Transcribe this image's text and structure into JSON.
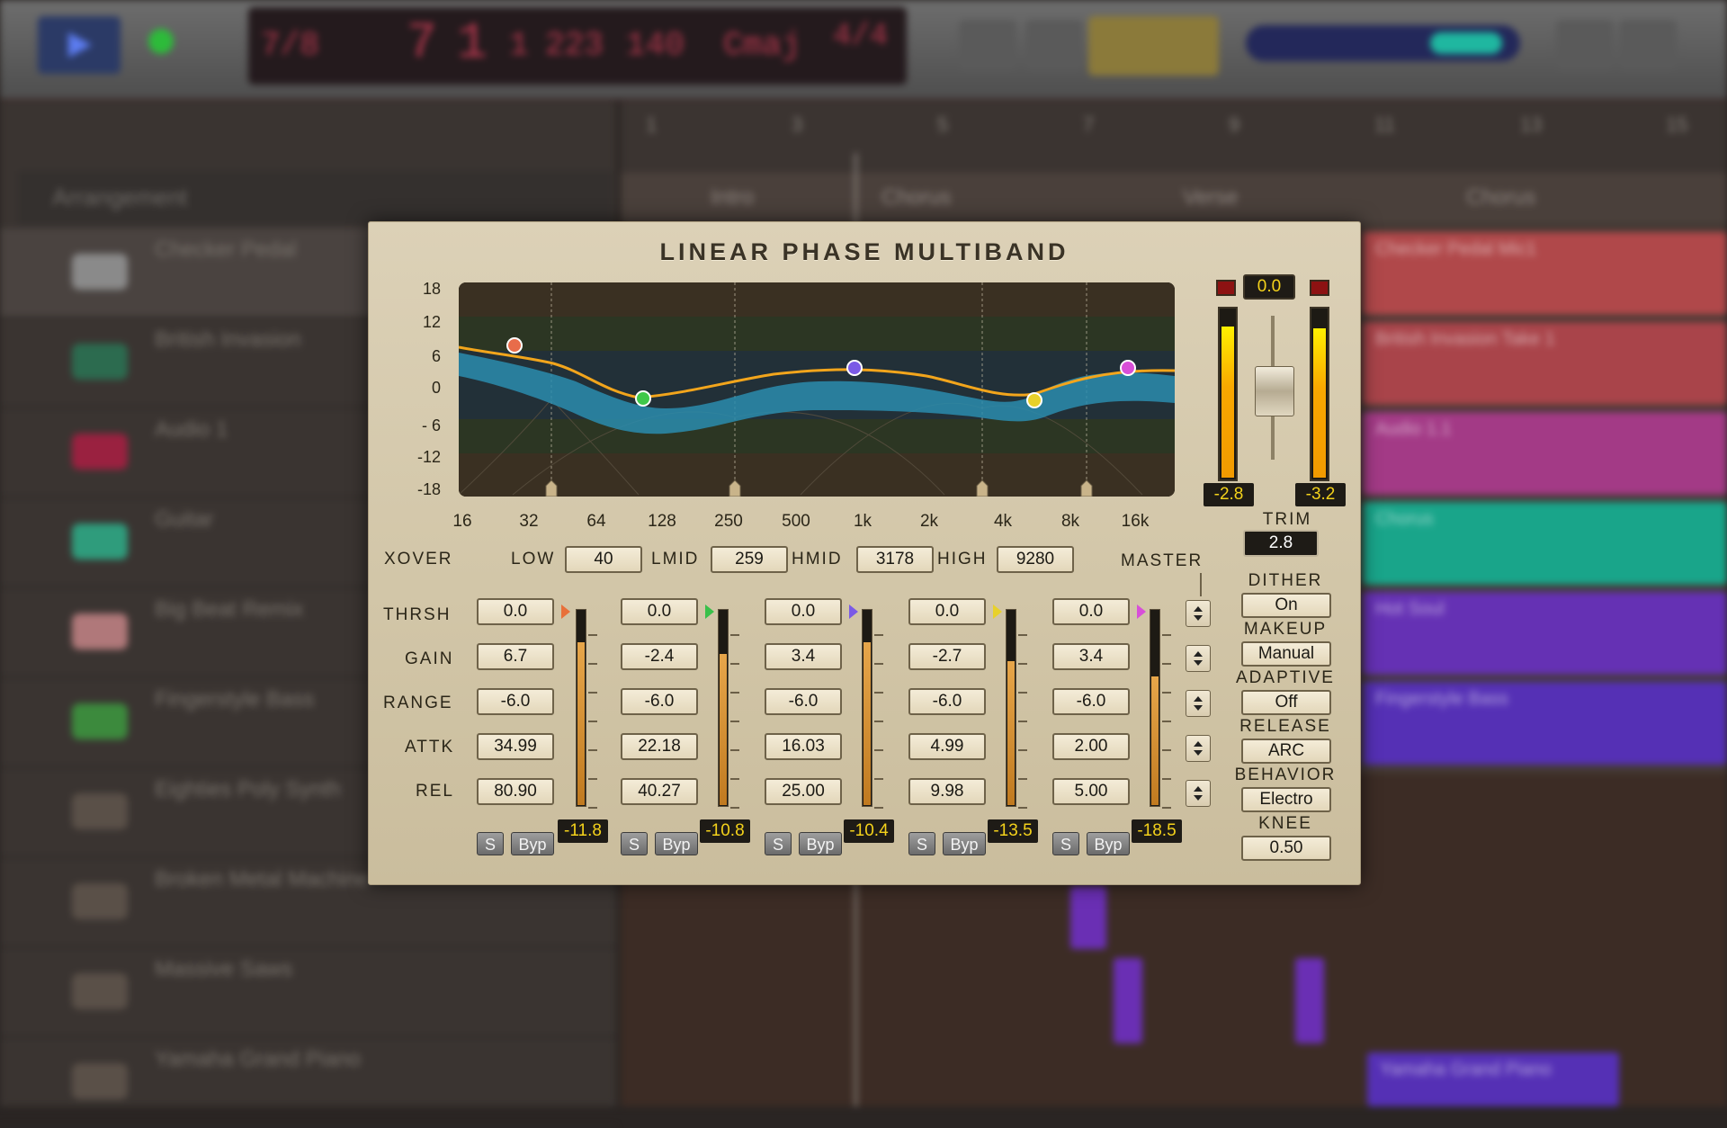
{
  "daw": {
    "transport_lcd": [
      "7/8",
      "7",
      "1",
      "1",
      "223",
      "140",
      "Cmaj",
      "4/4"
    ],
    "arrangement_label": "Arrangement",
    "ruler": [
      "1",
      "3",
      "5",
      "7",
      "9",
      "11",
      "13",
      "15"
    ],
    "markers": [
      "Intro",
      "Chorus",
      "Verse",
      "Chorus"
    ],
    "tracks": [
      "Checker Pedal",
      "British Invasion",
      "Audio 1",
      "Guitar",
      "Big Beat Remix",
      "Fingerstyle Bass",
      "Eighties Poly Synth",
      "Broken Metal Machine",
      "Massive Saws",
      "Yamaha Grand Piano"
    ],
    "regions": [
      "Checker Pedal Mic1",
      "British Invasion Take 1",
      "Audio 1.1",
      "Chorus",
      "Hot Soul",
      "Fingerstyle Bass",
      "Yamaha Grand Piano"
    ]
  },
  "plugin": {
    "title": "LINEAR PHASE MULTIBAND",
    "y_axis": [
      "18",
      "12",
      "6",
      "0",
      "- 6",
      "-12",
      "-18"
    ],
    "x_axis": [
      "16",
      "32",
      "64",
      "128",
      "250",
      "500",
      "1k",
      "2k",
      "4k",
      "8k",
      "16k"
    ],
    "xover": {
      "label": "XOVER",
      "low_label": "LOW",
      "low": "40",
      "lmid_label": "LMID",
      "lmid": "259",
      "hmid_label": "HMID",
      "hmid": "3178",
      "high_label": "HIGH",
      "high": "9280"
    },
    "row_labels": [
      "THRSH",
      "GAIN",
      "RANGE",
      "ATTK",
      "REL"
    ],
    "bands": [
      {
        "thrsh": "0.0",
        "gain": "6.7",
        "range": "-6.0",
        "attk": "34.99",
        "rel": "80.90",
        "meter": "-11.8",
        "s": "S",
        "byp": "Byp",
        "color": "#e8703a",
        "level": 0.84
      },
      {
        "thrsh": "0.0",
        "gain": "-2.4",
        "range": "-6.0",
        "attk": "22.18",
        "rel": "40.27",
        "meter": "-10.8",
        "s": "S",
        "byp": "Byp",
        "color": "#39c04a",
        "level": 0.78
      },
      {
        "thrsh": "0.0",
        "gain": "3.4",
        "range": "-6.0",
        "attk": "16.03",
        "rel": "25.00",
        "meter": "-10.4",
        "s": "S",
        "byp": "Byp",
        "color": "#7a5ae6",
        "level": 0.84
      },
      {
        "thrsh": "0.0",
        "gain": "-2.7",
        "range": "-6.0",
        "attk": "4.99",
        "rel": "9.98",
        "meter": "-13.5",
        "s": "S",
        "byp": "Byp",
        "color": "#e8d12a",
        "level": 0.74
      },
      {
        "thrsh": "0.0",
        "gain": "3.4",
        "range": "-6.0",
        "attk": "2.00",
        "rel": "5.00",
        "meter": "-18.5",
        "s": "S",
        "byp": "Byp",
        "color": "#d84fd8",
        "level": 0.66
      }
    ],
    "master": {
      "label": "MASTER",
      "output_value": "0.0",
      "meter_left": "-2.8",
      "meter_right": "-3.2",
      "trim_label": "TRIM",
      "trim": "2.8",
      "dither_label": "DITHER",
      "dither": "On",
      "makeup_label": "MAKEUP",
      "makeup": "Manual",
      "adaptive_label": "ADAPTIVE",
      "adaptive": "Off",
      "release_label": "RELEASE",
      "release": "ARC",
      "behavior_label": "BEHAVIOR",
      "behavior": "Electro",
      "knee_label": "KNEE",
      "knee": "0.50"
    },
    "colors": {
      "curve": "#f2a51c",
      "fill": "#2a8cae",
      "accent_yellow": "#f4d21b"
    }
  }
}
